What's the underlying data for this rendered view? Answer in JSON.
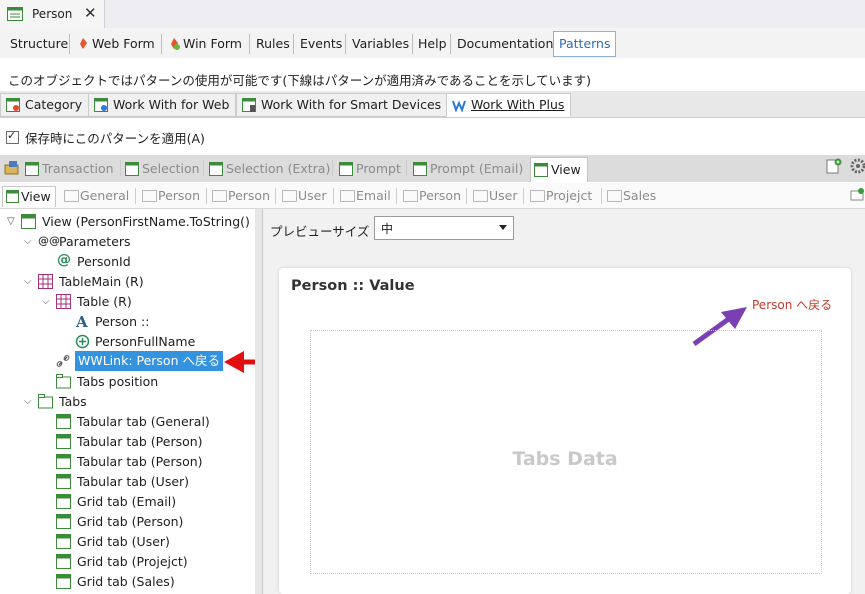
{
  "document_tab": {
    "title": "Person",
    "close": "✕"
  },
  "editor_tabs": [
    {
      "label": "Structure"
    },
    {
      "label": "Web Form"
    },
    {
      "label": "Win Form"
    },
    {
      "label": "Rules"
    },
    {
      "label": "Events"
    },
    {
      "label": "Variables"
    },
    {
      "label": "Help"
    },
    {
      "label": "Documentation"
    },
    {
      "label": "Patterns"
    }
  ],
  "info_text": "このオブジェクトではパターンの使用が可能です(下線はパターンが適用済みであることを示しています)",
  "pattern_tabs": [
    {
      "label": "Category"
    },
    {
      "label": "Work With for Web"
    },
    {
      "label": "Work With for Smart Devices"
    },
    {
      "label": "Work With Plus"
    }
  ],
  "apply_checkbox": {
    "label": "保存時にこのパターンを適用(A)",
    "checked": true
  },
  "instance_tabs": [
    {
      "label": "Transaction"
    },
    {
      "label": "Selection"
    },
    {
      "label": "Selection (Extra)"
    },
    {
      "label": "Prompt"
    },
    {
      "label": "Prompt (Email)"
    },
    {
      "label": "View"
    }
  ],
  "sub_tabs": [
    {
      "label": "View"
    },
    {
      "label": "General"
    },
    {
      "label": "Person"
    },
    {
      "label": "Person"
    },
    {
      "label": "User"
    },
    {
      "label": "Email"
    },
    {
      "label": "Person"
    },
    {
      "label": "User"
    },
    {
      "label": "Projejct"
    },
    {
      "label": "Sales"
    }
  ],
  "tree": {
    "root": "View (PersonFirstName.ToString()",
    "parameters": "Parameters",
    "person_id": "PersonId",
    "table_main": "TableMain (R)",
    "table": "Table (R)",
    "person_label": "Person ::",
    "person_full_name": "PersonFullName",
    "wwlink": "WWLink:  Person へ戻る",
    "tabs_position": "Tabs position",
    "tabs": "Tabs",
    "tab_items": [
      "Tabular tab (General)",
      "Tabular tab (Person)",
      "Tabular tab (Person)",
      "Tabular tab (User)",
      "Grid tab (Email)",
      "Grid tab (Person)",
      "Grid tab (User)",
      "Grid tab (Projejct)",
      "Grid tab (Sales)"
    ]
  },
  "preview": {
    "size_label": "プレビューサイズ",
    "size_value": "中",
    "card_title": "Person :: Value",
    "back_link": "Person へ戻る",
    "tabs_data": "Tabs Data"
  },
  "colors": {
    "selection": "#3393df",
    "link": "#c0392b",
    "red_arrow": "#e01010",
    "purple_arrow": "#7b3fb4",
    "accent": "#2d6db5"
  }
}
